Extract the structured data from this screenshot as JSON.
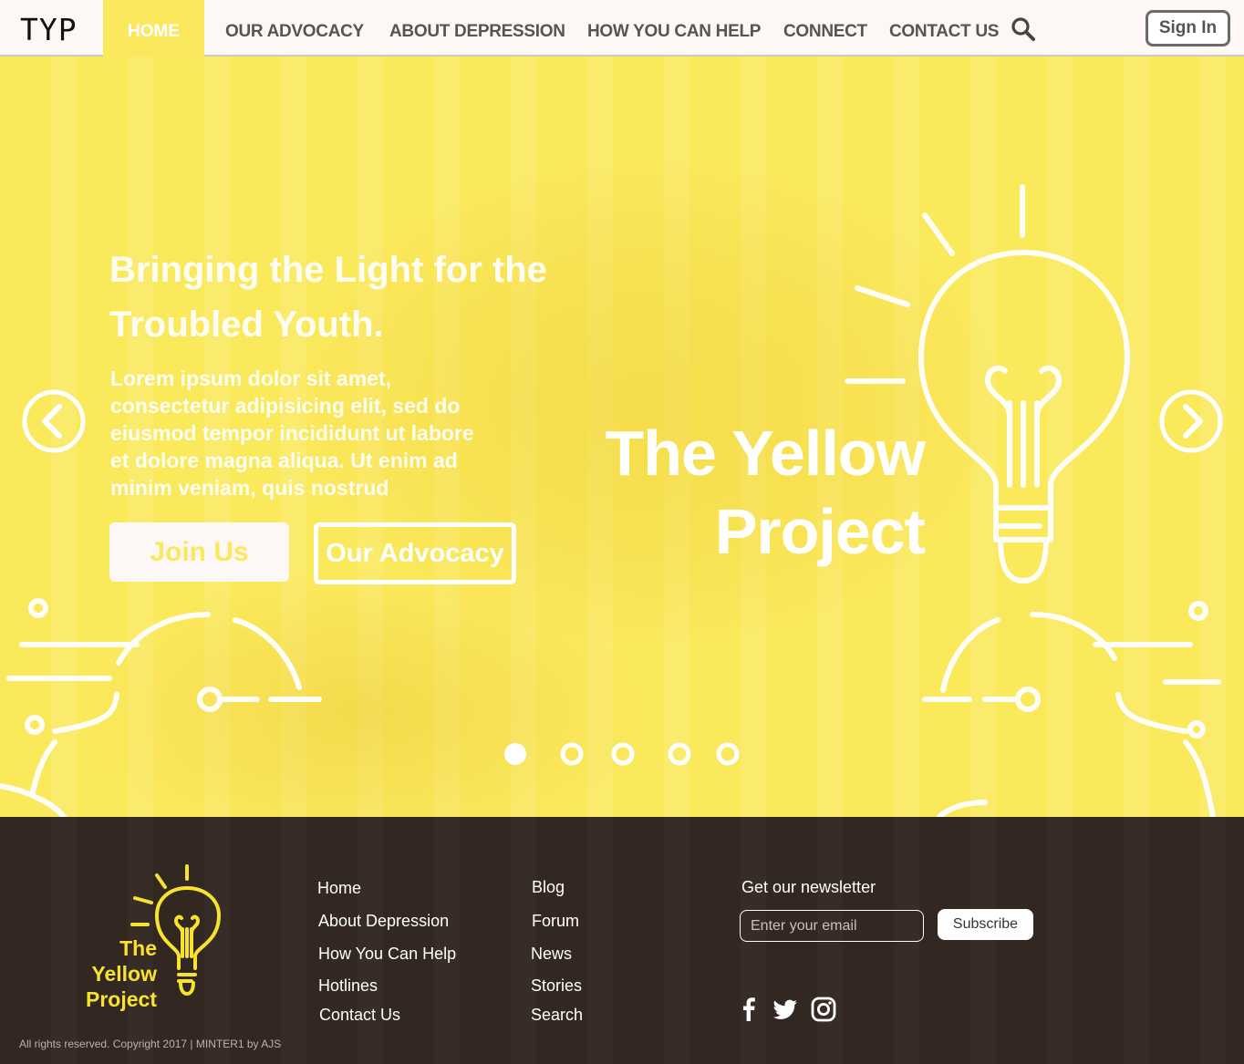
{
  "nav": {
    "logo": "TYP",
    "items": [
      {
        "label": "HOME",
        "active": true
      },
      {
        "label": "OUR ADVOCACY"
      },
      {
        "label": "ABOUT DEPRESSION"
      },
      {
        "label": "HOW YOU CAN HELP"
      },
      {
        "label": "CONNECT"
      },
      {
        "label": "CONTACT US"
      }
    ],
    "search_icon": "search-icon",
    "signin_label": "Sign In"
  },
  "hero": {
    "title": "Bringing the Light for the Troubled Youth.",
    "description": "Lorem ipsum dolor sit amet, consectetur adipisicing elit, sed do eiusmod tempor incididunt ut labore et dolore magna aliqua. Ut enim ad minim veniam, quis nostrud",
    "primary_button": "Join Us",
    "secondary_button": "Our Advocacy",
    "brand_line1": "The Yellow",
    "brand_line2": "Project",
    "slide_count": 5,
    "active_slide": 1,
    "prev_icon": "chevron-left-icon",
    "next_icon": "chevron-right-icon"
  },
  "footer": {
    "logo_line1": "The Yellow",
    "logo_line2": "Project",
    "links_col1": [
      "Home",
      "About Depression",
      "How You Can Help",
      "Hotlines",
      "Contact Us"
    ],
    "links_col2": [
      "Blog",
      "Forum",
      "News",
      "Stories",
      "Search"
    ],
    "newsletter_title": "Get our newsletter",
    "email_placeholder": "Enter your email",
    "subscribe_label": "Subscribe",
    "social_icons": [
      "facebook-icon",
      "twitter-icon",
      "instagram-icon"
    ],
    "copyright": "All rights reserved. Copyright 2017 | MINTER1 by AJS"
  },
  "colors": {
    "yellow": "#fbe85c",
    "logo_yellow": "#f7e32f",
    "footer_bg": "#332722",
    "nav_bg": "#fdf7f5"
  }
}
